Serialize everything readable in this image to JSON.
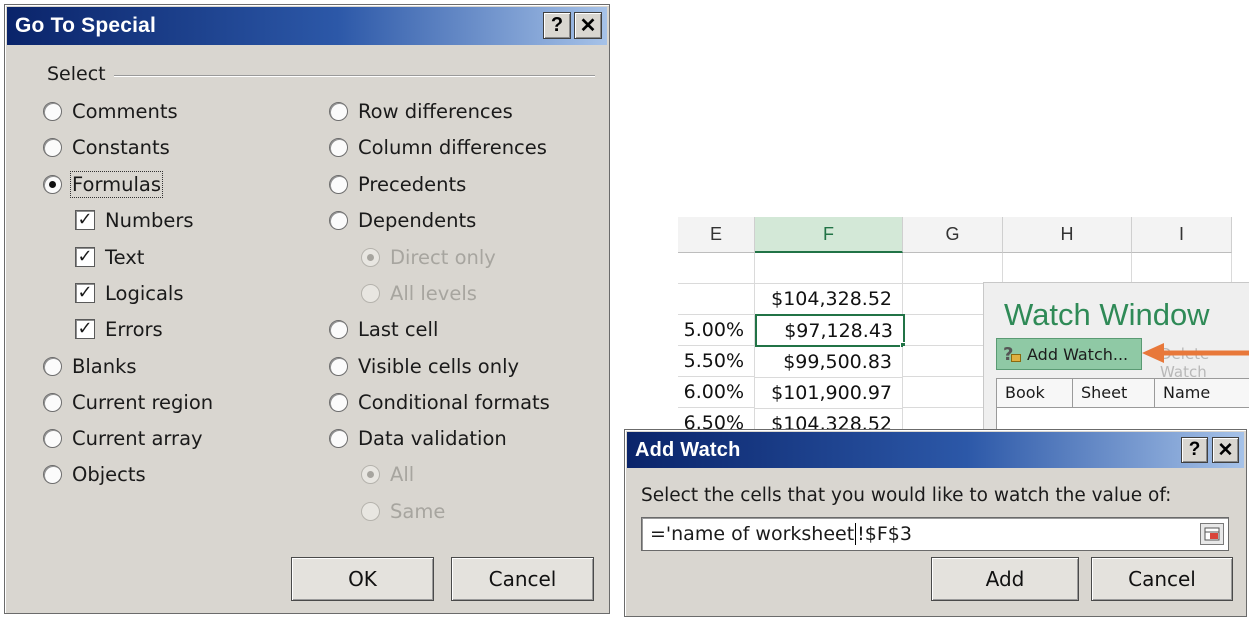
{
  "go_to_special": {
    "title": "Go To Special",
    "help_label": "?",
    "close_label": "✕",
    "group_label": "Select",
    "left_options": [
      {
        "label": "Comments",
        "selected": false
      },
      {
        "label": "Constants",
        "selected": false
      },
      {
        "label": "Formulas",
        "selected": true
      }
    ],
    "formula_types": [
      {
        "label": "Numbers",
        "checked": true
      },
      {
        "label": "Text",
        "checked": true
      },
      {
        "label": "Logicals",
        "checked": true
      },
      {
        "label": "Errors",
        "checked": true
      }
    ],
    "left_options_2": [
      {
        "label": "Blanks"
      },
      {
        "label": "Current region"
      },
      {
        "label": "Current array"
      },
      {
        "label": "Objects"
      }
    ],
    "right_options": [
      {
        "label": "Row differences"
      },
      {
        "label": "Column differences"
      },
      {
        "label": "Precedents"
      },
      {
        "label": "Dependents"
      }
    ],
    "dependents_sub": [
      {
        "label": "Direct only",
        "selected": true,
        "enabled": false
      },
      {
        "label": "All levels",
        "selected": false,
        "enabled": false
      }
    ],
    "right_options_2": [
      {
        "label": "Last cell"
      },
      {
        "label": "Visible cells only"
      },
      {
        "label": "Conditional formats"
      },
      {
        "label": "Data validation"
      }
    ],
    "validation_sub": [
      {
        "label": "All",
        "selected": true,
        "enabled": false
      },
      {
        "label": "Same",
        "selected": false,
        "enabled": false
      }
    ],
    "ok_label": "OK",
    "cancel_label": "Cancel"
  },
  "sheet": {
    "columns": [
      "E",
      "F",
      "G",
      "H",
      "I"
    ],
    "active_column": "F",
    "rows": [
      {
        "e": "",
        "f": ""
      },
      {
        "e": "",
        "f": "$104,328.52"
      },
      {
        "e": "5.00%",
        "f": "$97,128.43"
      },
      {
        "e": "5.50%",
        "f": "$99,500.83"
      },
      {
        "e": "6.00%",
        "f": "$101,900.97"
      },
      {
        "e": "6.50%",
        "f": "$104,328.52"
      }
    ]
  },
  "watch_window": {
    "title": "Watch Window",
    "add_watch_label": "Add Watch...",
    "delete_watch_label": "Delete Watch",
    "columns": [
      "Book",
      "Sheet",
      "Name"
    ]
  },
  "add_watch": {
    "title": "Add Watch",
    "help_label": "?",
    "close_label": "✕",
    "prompt": "Select the cells that you would like to watch the value of:",
    "ref_before_caret": "='name of worksheet",
    "ref_after_caret": "!$F$3",
    "add_label": "Add",
    "cancel_label": "Cancel"
  },
  "colors": {
    "title_gradient_start": "#0a246a",
    "excel_green": "#217346",
    "watch_title_green": "#2f8a57",
    "arrow_orange": "#e8783a"
  }
}
